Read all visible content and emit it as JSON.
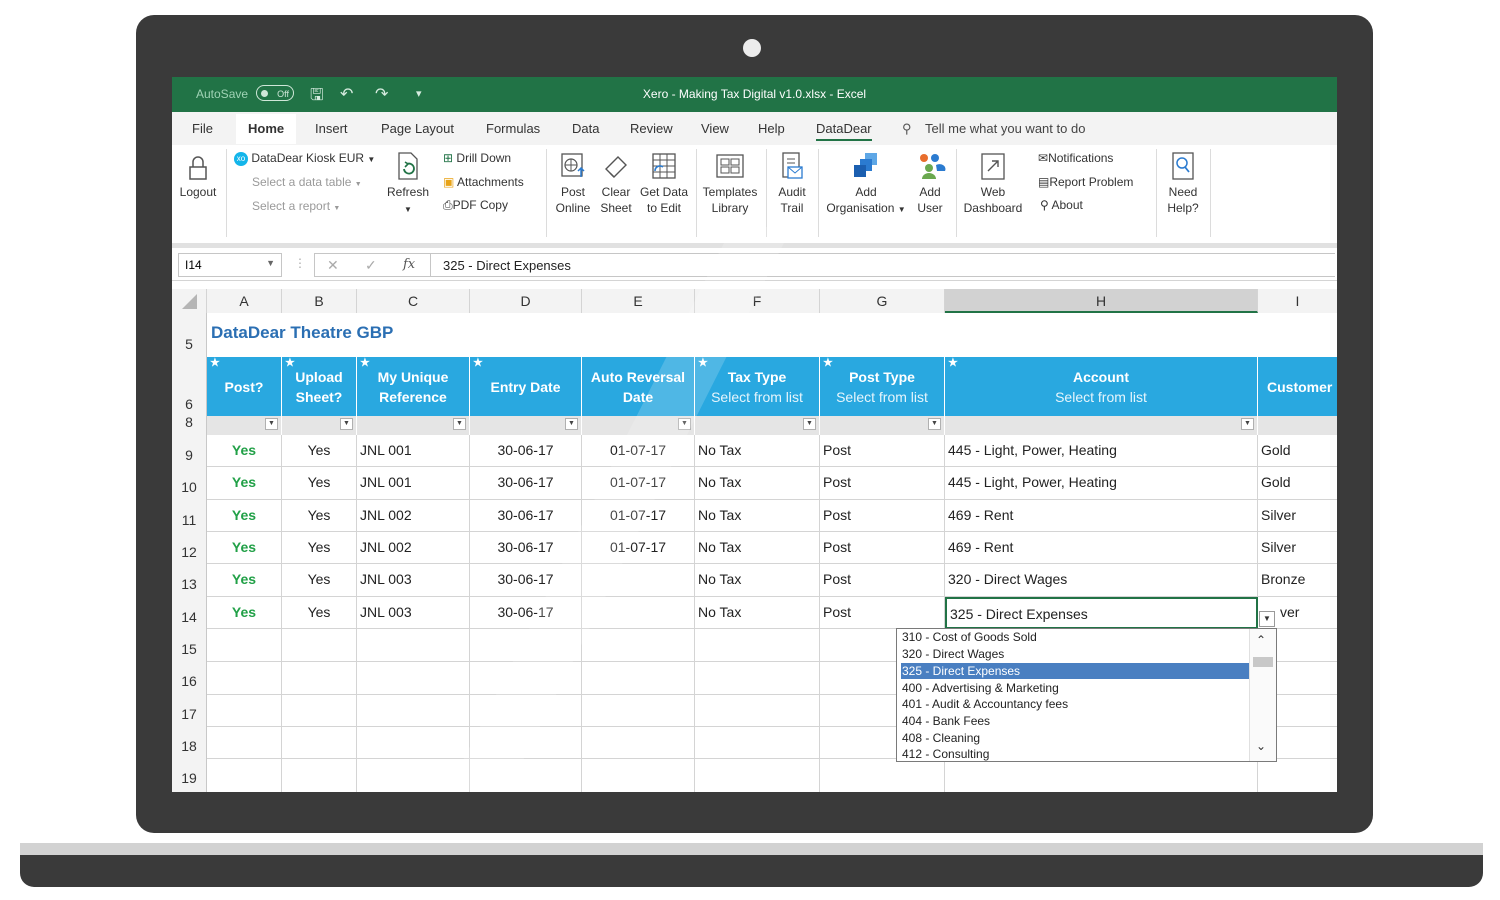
{
  "window": {
    "autosave_label": "AutoSave",
    "autosave_state": "Off",
    "title": "Xero - Making Tax Digital v1.0.xlsx  -  Excel"
  },
  "tabs": [
    "File",
    "Home",
    "Insert",
    "Page Layout",
    "Formulas",
    "Data",
    "Review",
    "View",
    "Help",
    "DataDear"
  ],
  "tell_me": "Tell me what you want to do",
  "ribbon": {
    "logout": "Logout",
    "kiosk": "DataDear Kiosk EUR",
    "kiosk_badge": "xo",
    "select_table": "Select a data table",
    "select_report": "Select a report",
    "refresh": "Refresh",
    "drill_down": "Drill Down",
    "attachments": "Attachments",
    "pdf_copy": "PDF Copy",
    "post_online": [
      "Post",
      "Online"
    ],
    "clear_sheet": [
      "Clear",
      "Sheet"
    ],
    "get_data": [
      "Get Data",
      "to Edit"
    ],
    "templates": [
      "Templates",
      "Library"
    ],
    "audit": [
      "Audit",
      "Trail"
    ],
    "add_org": [
      "Add",
      "Organisation"
    ],
    "add_user": [
      "Add",
      "User"
    ],
    "web_dashboard": [
      "Web",
      "Dashboard"
    ],
    "notifications": "Notifications",
    "report_problem": "Report Problem",
    "about": "About",
    "need_help": [
      "Need",
      "Help?"
    ]
  },
  "formula_bar": {
    "cell_ref": "I14",
    "fx": "fx",
    "value": "325 - Direct Expenses"
  },
  "columns": [
    "A",
    "B",
    "C",
    "D",
    "E",
    "F",
    "G",
    "H",
    "I"
  ],
  "sheet": {
    "title": "DataDear Theatre GBP",
    "headers": [
      {
        "line1": "Post?",
        "line2": ""
      },
      {
        "line1": "Upload",
        "line2": "Sheet?"
      },
      {
        "line1": "My Unique",
        "line2": "Reference"
      },
      {
        "line1": "Entry Date",
        "line2": ""
      },
      {
        "line1": "Auto Reversal",
        "line2": "Date"
      },
      {
        "line1": "Tax Type",
        "line2": "Select from list"
      },
      {
        "line1": "Post Type",
        "line2": "Select from list"
      },
      {
        "line1": "Account",
        "line2": "Select from list"
      },
      {
        "line1": "Customer",
        "line2": ""
      }
    ],
    "row_numbers": [
      "5",
      "6",
      "8",
      "9",
      "10",
      "11",
      "12",
      "13",
      "14",
      "15",
      "16",
      "17",
      "18",
      "19"
    ],
    "rows": [
      [
        "Yes",
        "Yes",
        "JNL 001",
        "30-06-17",
        "01-07-17",
        "No Tax",
        "Post",
        "445 - Light, Power, Heating",
        "Gold"
      ],
      [
        "Yes",
        "Yes",
        "JNL 001",
        "30-06-17",
        "01-07-17",
        "No Tax",
        "Post",
        "445 - Light, Power, Heating",
        "Gold"
      ],
      [
        "Yes",
        "Yes",
        "JNL 002",
        "30-06-17",
        "01-07-17",
        "No Tax",
        "Post",
        "469 - Rent",
        "Silver"
      ],
      [
        "Yes",
        "Yes",
        "JNL 002",
        "30-06-17",
        "01-07-17",
        "No Tax",
        "Post",
        "469 - Rent",
        "Silver"
      ],
      [
        "Yes",
        "Yes",
        "JNL 003",
        "30-06-17",
        "",
        "No Tax",
        "Post",
        "320 - Direct Wages",
        "Bronze"
      ],
      [
        "Yes",
        "Yes",
        "JNL 003",
        "30-06-17",
        "",
        "No Tax",
        "Post",
        "325 - Direct Expenses",
        "ver"
      ]
    ]
  },
  "dropdown": {
    "items": [
      "310 - Cost of Goods Sold",
      "320 - Direct Wages",
      "325 - Direct Expenses",
      "400 - Advertising & Marketing",
      "401 - Audit & Accountancy fees",
      "404 - Bank Fees",
      "408 - Cleaning",
      "412 - Consulting"
    ],
    "selected": "325 - Direct Expenses"
  },
  "colors": {
    "excel_green": "#217346",
    "header_blue": "#29a8e0",
    "yes_green": "#21a047",
    "selected_item": "#4a7fc1",
    "laptop_frame": "#3a3a3a"
  }
}
